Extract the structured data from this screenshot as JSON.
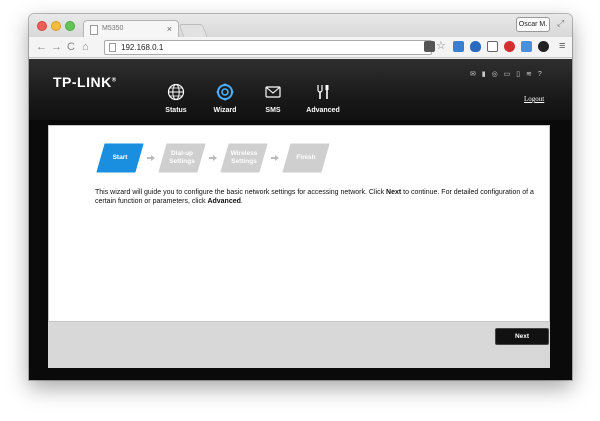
{
  "browser": {
    "tab_title": "M5350",
    "tab_close": "×",
    "user_name": "Oscar M.",
    "url": "192.168.0.1",
    "nav_back": "←",
    "nav_forward": "→",
    "nav_reload": "C",
    "nav_home": "⌂",
    "fullscreen_glyph": "⤢",
    "menu_glyph": "≡",
    "star_glyph": "☆"
  },
  "router": {
    "logo": "TP-LINK",
    "logo_mark": "®",
    "logout": "Logout",
    "status_glyphs": "✉ ▮ ◎ ▭ ▯ ≋ ?",
    "nav": [
      {
        "label": "Status",
        "icon": "globe-icon"
      },
      {
        "label": "Wizard",
        "icon": "wizard-gear-icon",
        "active": true
      },
      {
        "label": "SMS",
        "icon": "envelope-icon"
      },
      {
        "label": "Advanced",
        "icon": "tools-icon"
      }
    ],
    "wizard": {
      "steps": [
        {
          "line1": "Start",
          "line2": "",
          "active": true
        },
        {
          "line1": "Dial-up",
          "line2": "Settings",
          "active": false
        },
        {
          "line1": "Wireless",
          "line2": "Settings",
          "active": false
        },
        {
          "line1": "Finish",
          "line2": "",
          "active": false
        }
      ],
      "description_part1": "This wizard will guide you to configure the basic network settings for accessing network. Click ",
      "description_next": "Next",
      "description_part2": " to continue. For detailed configuration of a certain function or parameters, click ",
      "description_advanced": "Advanced",
      "description_end": "."
    },
    "next_button": "Next"
  },
  "colors": {
    "active_step": "#1a8fe0",
    "inactive_step": "#cfcfcf",
    "header_bg": "#1a1a1a",
    "active_nav_icon": "#4ab0ff"
  }
}
